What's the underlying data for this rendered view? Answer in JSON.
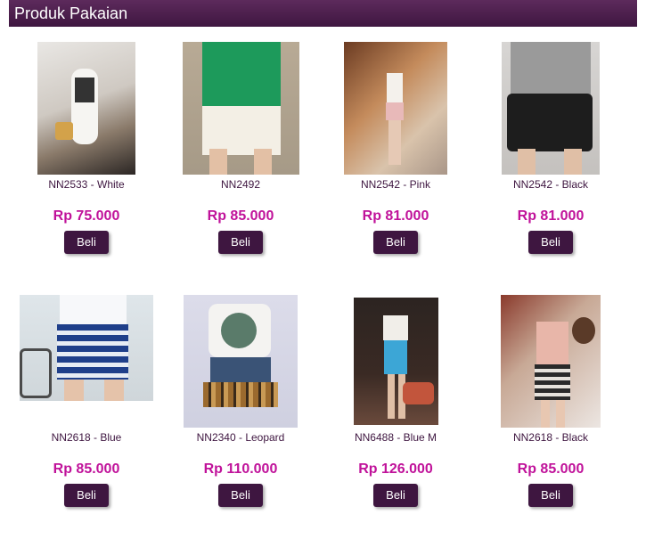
{
  "header": {
    "title": "Produk Pakaian"
  },
  "products": [
    {
      "name": "NN2533 - White",
      "price": "Rp 75.000",
      "button": "Beli"
    },
    {
      "name": "NN2492",
      "price": "Rp 85.000",
      "button": "Beli"
    },
    {
      "name": "NN2542 - Pink",
      "price": "Rp 81.000",
      "button": "Beli"
    },
    {
      "name": "NN2542 - Black",
      "price": "Rp 81.000",
      "button": "Beli"
    },
    {
      "name": "NN2618 - Blue",
      "price": "Rp 85.000",
      "button": "Beli"
    },
    {
      "name": "NN2340 - Leopard",
      "price": "Rp 110.000",
      "button": "Beli"
    },
    {
      "name": "NN6488 - Blue M",
      "price": "Rp 126.000",
      "button": "Beli"
    },
    {
      "name": "NN2618 - Black",
      "price": "Rp 85.000",
      "button": "Beli"
    }
  ],
  "colors": {
    "header": "#4a1d4a",
    "price": "#c0129a",
    "button": "#3e1640",
    "name": "#3e1640"
  }
}
